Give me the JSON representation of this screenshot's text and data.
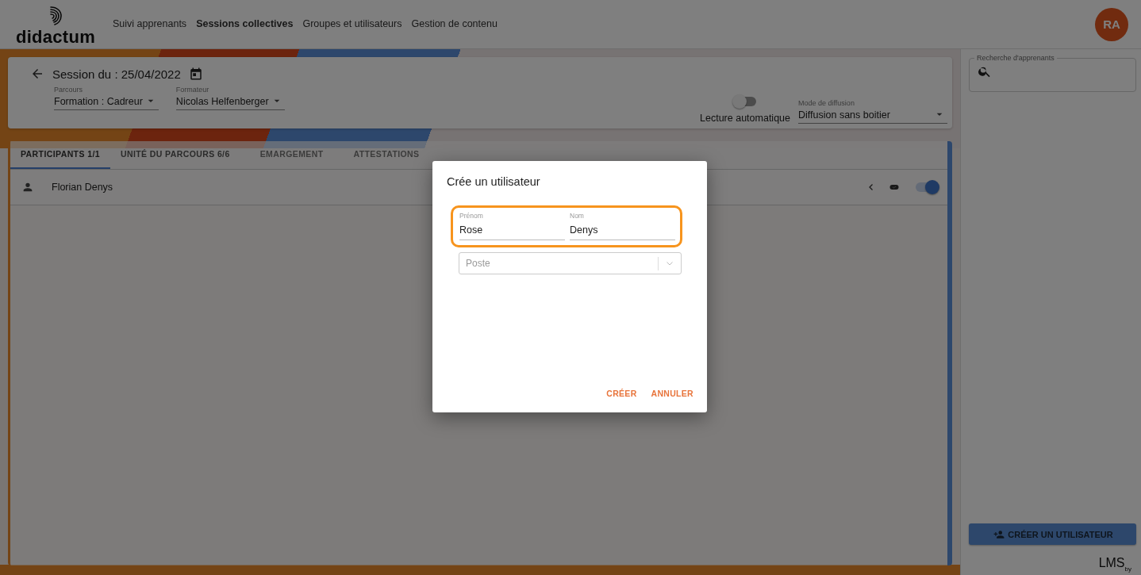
{
  "header": {
    "logo": "didactum",
    "nav": [
      {
        "label": "Suivi apprenants",
        "selected": false
      },
      {
        "label": "Sessions collectives",
        "selected": true
      },
      {
        "label": "Groupes et utilisateurs",
        "selected": false
      },
      {
        "label": "Gestion de contenu",
        "selected": false
      }
    ],
    "avatar": "RA"
  },
  "session": {
    "title": "Session du : 25/04/2022",
    "selects": [
      {
        "label": "Parcours",
        "value": "Formation : Cadreur"
      },
      {
        "label": "Formateur",
        "value": "Nicolas Helfenberger"
      }
    ],
    "autoplay": {
      "label": "Lecture automatique",
      "on": false
    },
    "mode": {
      "label": "Mode de diffusion",
      "value": "Diffusion sans boitier"
    }
  },
  "tabs": [
    {
      "label": "PARTICIPANTS 1/1",
      "selected": true,
      "disabled": false
    },
    {
      "label": "UNITÉ DU PARCOURS 6/6",
      "selected": false,
      "disabled": false
    },
    {
      "label": "EMARGEMENT",
      "selected": false,
      "disabled": true
    },
    {
      "label": "ATTESTATIONS",
      "selected": false,
      "disabled": true
    }
  ],
  "participants": [
    {
      "name": "Florian Denys",
      "on": true
    }
  ],
  "sidebar": {
    "search": {
      "label": "Recherche d'apprenants"
    },
    "create_button": "CRÉER UN UTILISATEUR",
    "brand": "LMS",
    "brand_sub": "by"
  },
  "dialog": {
    "title": "Crée un utilisateur",
    "highlighted": true,
    "fields": [
      {
        "label": "Prénom",
        "value": "Rose"
      },
      {
        "label": "Nom",
        "value": "Denys"
      }
    ],
    "select": {
      "placeholder": "Poste"
    },
    "buttons": [
      "CRÉER",
      "ANNULER"
    ]
  }
}
